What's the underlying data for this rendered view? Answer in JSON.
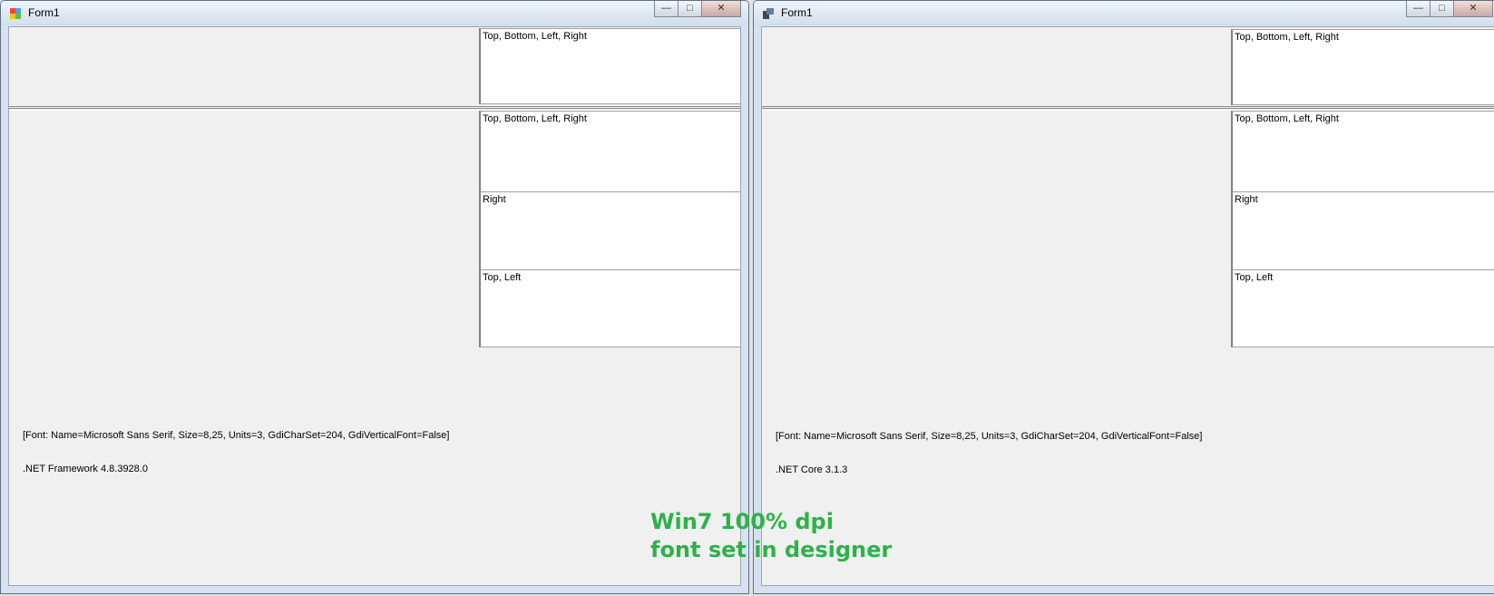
{
  "windows": [
    {
      "title": "Form1",
      "controls": {
        "minimize": "—",
        "maximize": "□",
        "close": "✕"
      },
      "top_panel_text": "Top, Bottom, Left, Right",
      "boxes": [
        "Top, Bottom, Left, Right",
        "Right",
        "Top, Left"
      ],
      "font_info": "[Font: Name=Microsoft Sans Serif, Size=8,25, Units=3, GdiCharSet=204, GdiVerticalFont=False]",
      "runtime": ".NET Framework 4.8.3928.0"
    },
    {
      "title": "Form1",
      "controls": {
        "minimize": "—",
        "maximize": "□",
        "close": "✕"
      },
      "top_panel_text": "Top, Bottom, Left, Right",
      "boxes": [
        "Top, Bottom, Left, Right",
        "Right",
        "Top, Left"
      ],
      "font_info": "[Font: Name=Microsoft Sans Serif, Size=8,25, Units=3, GdiCharSet=204, GdiVerticalFont=False]",
      "runtime": ".NET Core 3.1.3"
    }
  ],
  "overlay": {
    "line1": "Win7 100% dpi",
    "line2": "font set in designer",
    "color": "#2db24a"
  }
}
